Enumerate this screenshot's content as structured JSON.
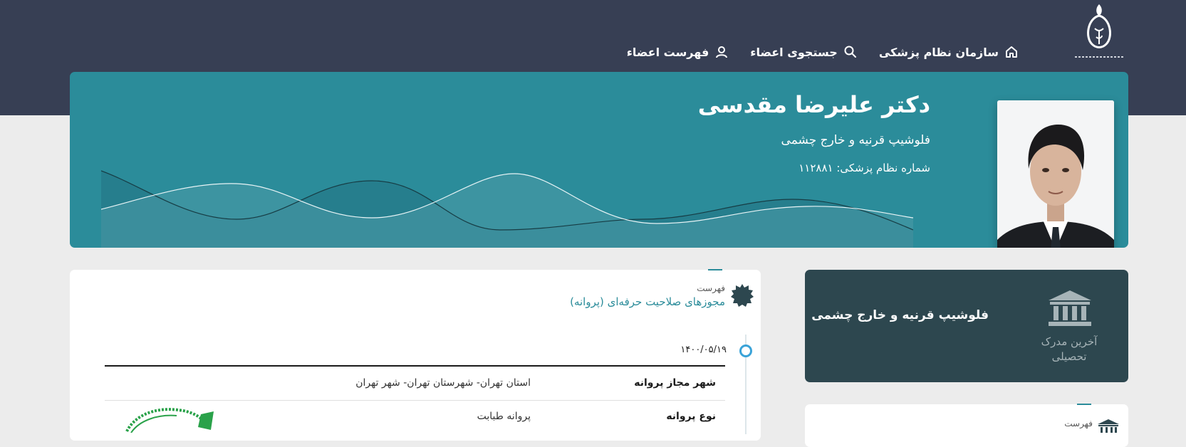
{
  "header": {
    "nav": [
      {
        "label": "سازمان نظام پزشکی",
        "icon": "home-icon"
      },
      {
        "label": "جستجوی اعضاء",
        "icon": "search-icon"
      },
      {
        "label": "فهرست اعضاء",
        "icon": "user-icon"
      }
    ]
  },
  "profile": {
    "name": "دکتر علیرضا مقدسی",
    "specialty": "فلوشیپ قرنیه و خارج چشمی",
    "license_number_text": "شماره نظام پزشکی: ۱۱۲۸۸۱"
  },
  "licenses": {
    "section_subtitle": "فهرست",
    "section_title": "مجوزهای صلاحیت حرفه‌ای (پروانه)",
    "date": "۱۴۰۰/۰۵/۱۹",
    "rows": [
      {
        "label": "شهر مجاز پروانه",
        "value": "استان تهران- شهرستان تهران- شهر تهران"
      },
      {
        "label": "نوع پروانه",
        "value": "پروانه طبابت"
      }
    ]
  },
  "education": {
    "label": "آخرین مدرک تحصیلی",
    "value": "فلوشیپ قرنیه و خارج چشمی"
  },
  "second_card": {
    "subtitle": "فهرست"
  },
  "colors": {
    "topbar": "#373f54",
    "hero": "#2b8c9a",
    "edu_card": "#2d474f",
    "accent": "#2b8c9a",
    "timeline_dot": "#3aa3d8"
  }
}
